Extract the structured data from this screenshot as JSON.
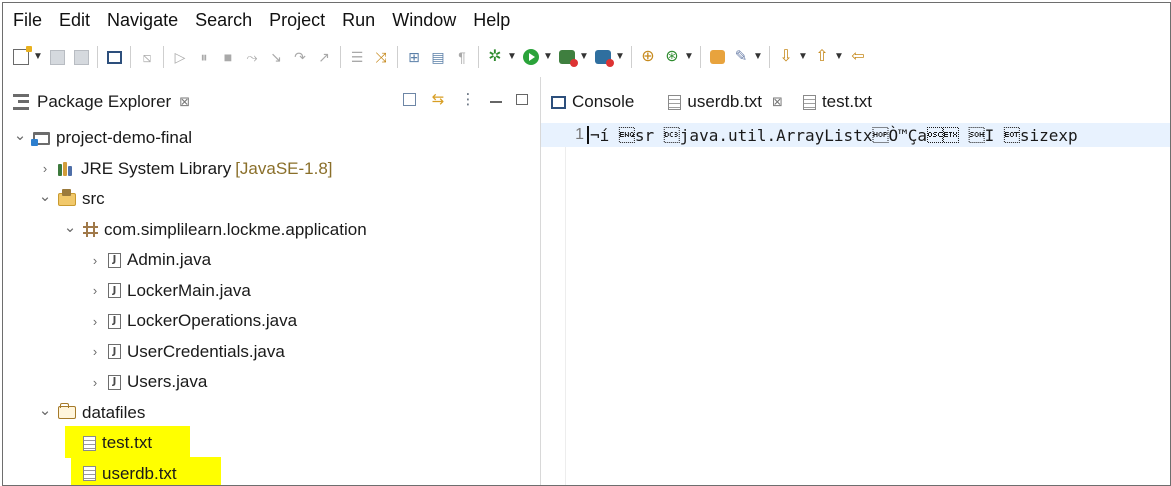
{
  "menu": [
    "File",
    "Edit",
    "Navigate",
    "Search",
    "Project",
    "Run",
    "Window",
    "Help"
  ],
  "toolbar": {
    "icons": [
      "new-icon",
      "save-icon",
      "save-all-icon",
      "console-icon",
      "skip-breakpoints-icon",
      "resume-icon",
      "suspend-icon",
      "terminate-icon",
      "disconnect-icon",
      "step-into-icon",
      "step-over-icon",
      "step-return-icon",
      "drop-to-frame-icon",
      "use-step-filters-icon",
      "open-type-icon",
      "show-whitespace-icon",
      "debug-icon",
      "run-icon",
      "run-coverage-icon",
      "external-tools-icon",
      "new-java-class-icon",
      "open-task-icon",
      "search-icon",
      "next-annotation-icon",
      "previous-annotation-icon",
      "back-icon"
    ]
  },
  "package_explorer": {
    "title": "Package Explorer",
    "close_glyph": "⊠",
    "tree": [
      {
        "indent": 0,
        "twisty": "expanded",
        "icon": "project-icon",
        "label": "project-demo-final",
        "aux": ""
      },
      {
        "indent": 1,
        "twisty": "collapsed",
        "icon": "library-icon",
        "label": "JRE System Library",
        "aux": "[JavaSE-1.8]"
      },
      {
        "indent": 1,
        "twisty": "expanded",
        "icon": "source-folder-icon",
        "label": "src",
        "aux": ""
      },
      {
        "indent": 2,
        "twisty": "expanded",
        "icon": "package-icon",
        "label": "com.simplilearn.lockme.application",
        "aux": ""
      },
      {
        "indent": 3,
        "twisty": "collapsed",
        "icon": "java-file-icon",
        "label": "Admin.java",
        "aux": ""
      },
      {
        "indent": 3,
        "twisty": "collapsed",
        "icon": "java-file-icon",
        "label": "LockerMain.java",
        "aux": ""
      },
      {
        "indent": 3,
        "twisty": "collapsed",
        "icon": "java-file-icon",
        "label": "LockerOperations.java",
        "aux": ""
      },
      {
        "indent": 3,
        "twisty": "collapsed",
        "icon": "java-file-icon",
        "label": "UserCredentials.java",
        "aux": ""
      },
      {
        "indent": 3,
        "twisty": "collapsed",
        "icon": "java-file-icon",
        "label": "Users.java",
        "aux": ""
      },
      {
        "indent": 1,
        "twisty": "expanded",
        "icon": "folder-icon",
        "label": "datafiles",
        "aux": ""
      },
      {
        "indent": 2,
        "twisty": "none",
        "icon": "text-file-icon",
        "label": "test.txt",
        "aux": ""
      },
      {
        "indent": 2,
        "twisty": "none",
        "icon": "text-file-icon",
        "label": "userdb.txt",
        "aux": ""
      }
    ],
    "highlight_color": "#ffff00"
  },
  "editor": {
    "tabs": [
      {
        "label": "Console",
        "icon": "console-icon",
        "closable": false,
        "active": false
      },
      {
        "label": "userdb.txt",
        "icon": "text-file-icon",
        "closable": true,
        "active": true
      },
      {
        "label": "test.txt",
        "icon": "text-file-icon",
        "closable": false,
        "active": false
      }
    ],
    "close_glyph": "⊠",
    "lines": [
      {
        "number": "1",
        "text": "¬í \u0005sr \u0013java.util.ArrayListxÒ™Ça\u0003 \u0001I \u0004sizexp"
      }
    ],
    "current_line_color": "#e8f2fe"
  }
}
